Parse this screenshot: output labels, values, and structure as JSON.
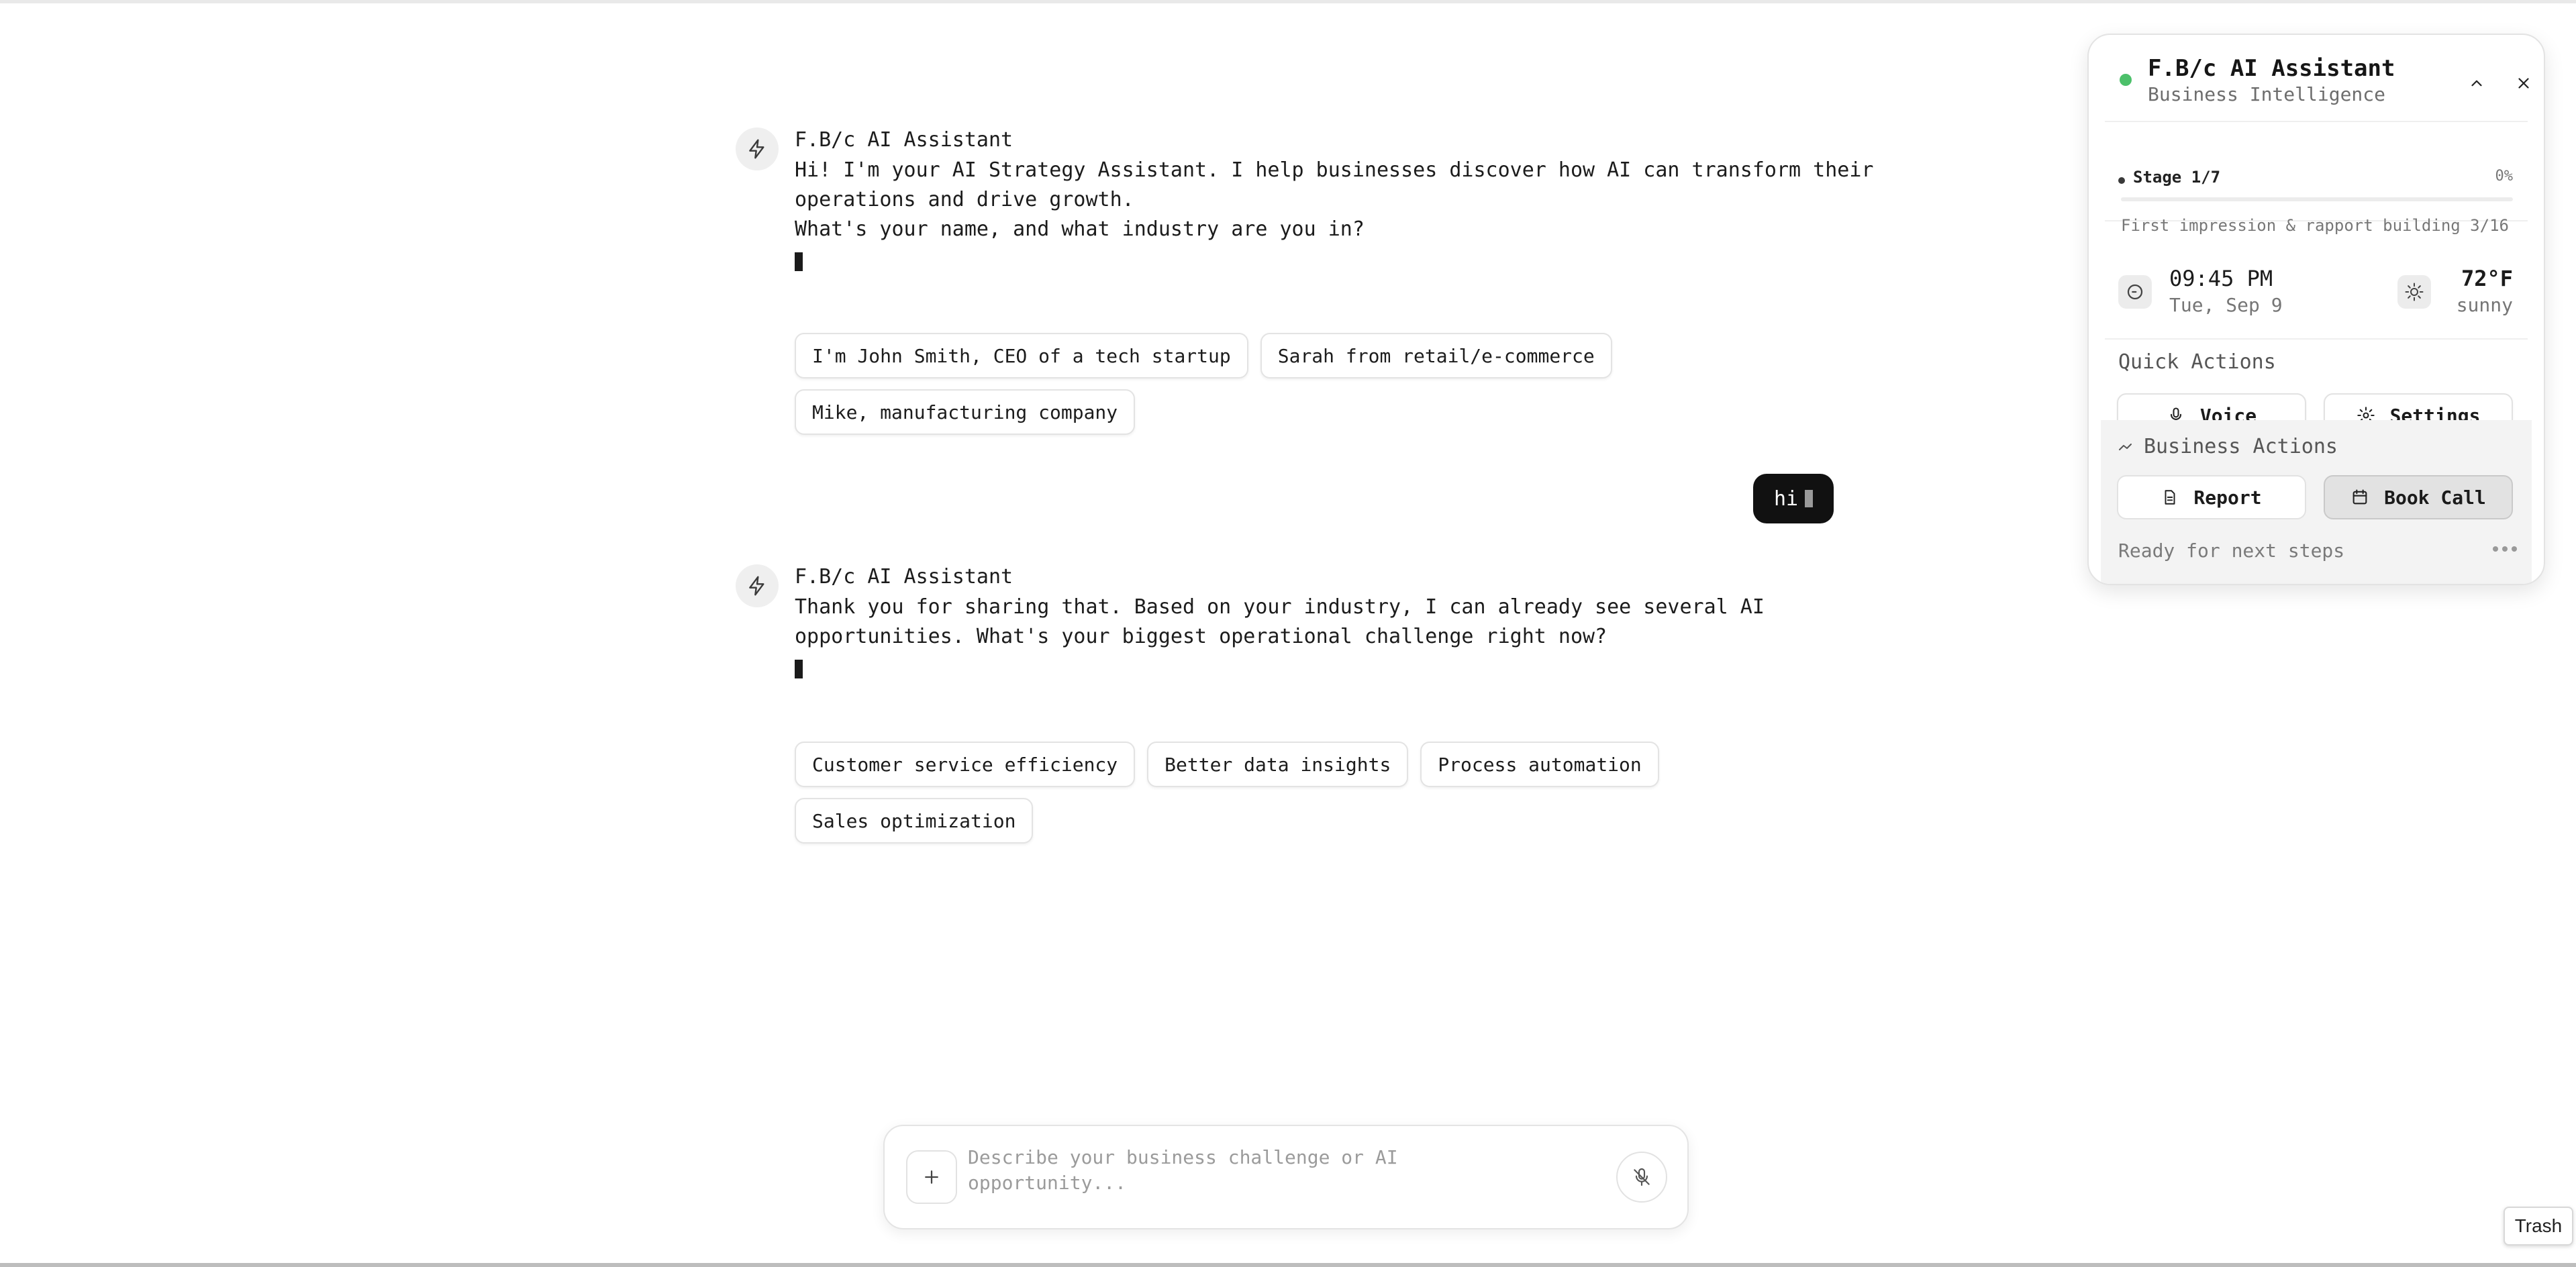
{
  "assistant": {
    "name": "F.B/c AI Assistant"
  },
  "messages": [
    {
      "sender": "F.B/c AI Assistant",
      "lines": [
        "Hi! I'm your AI Strategy Assistant. I help businesses discover how AI can transform their",
        "operations and drive growth.",
        "What's your name, and what industry are you in?"
      ],
      "suggestions": [
        "I'm John Smith, CEO of a tech startup",
        "Sarah from retail/e-commerce",
        "Mike, manufacturing company"
      ]
    },
    {
      "sender": "F.B/c AI Assistant",
      "lines": [
        "Thank you for sharing that. Based on your industry, I can already see several AI",
        "opportunities. What's your biggest operational challenge right now?"
      ],
      "suggestions": [
        "Customer service efficiency",
        "Better data insights",
        "Process automation",
        "Sales optimization"
      ]
    }
  ],
  "user_message": "hi",
  "composer": {
    "placeholder": "Describe your business challenge or AI opportunity...",
    "value": ""
  },
  "panel": {
    "title": "F.B/c AI Assistant",
    "subtitle": "Business Intelligence",
    "status_color": "#4cc06a",
    "stage": {
      "label": "Stage 1/7",
      "percent_text": "0%",
      "progress": 0,
      "description": "First impression & rapport building 3/16"
    },
    "clock": {
      "time": "09:45 PM",
      "date": "Tue, Sep 9"
    },
    "weather": {
      "temp": "72°F",
      "condition": "sunny"
    },
    "quick_actions": {
      "label": "Quick Actions",
      "voice": "Voice",
      "settings": "Settings"
    },
    "business_actions": {
      "label": "Business Actions",
      "report": "Report",
      "book_call": "Book Call"
    },
    "status_text": "Ready for next steps"
  },
  "tooltip": "Trash"
}
